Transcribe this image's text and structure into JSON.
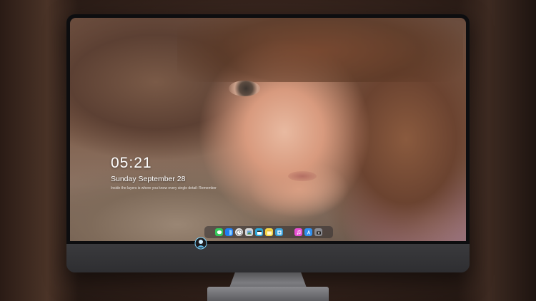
{
  "lockscreen": {
    "time": "05:21",
    "date": "Sunday September  28",
    "caption": "Inside the layers is where you know every single detail: Remember"
  },
  "dock": {
    "items": [
      {
        "name": "messages-icon",
        "color": "#34c759",
        "glyph": "◉"
      },
      {
        "name": "finder-icon",
        "color": "#1e7cf2",
        "glyph": "◧"
      },
      {
        "name": "clock-icon",
        "color": "#e8e8e8",
        "glyph": "◔"
      },
      {
        "name": "photos-icon",
        "color": "#c9c9c9",
        "glyph": "▦"
      },
      {
        "name": "claquette-icon",
        "color": "#2fa8d8",
        "glyph": "▤"
      },
      {
        "name": "notes-icon",
        "color": "#f5d547",
        "glyph": "▬"
      },
      {
        "name": "preview-icon",
        "color": "#3aa0d8",
        "glyph": "▣"
      },
      {
        "name": "itunes-icon",
        "color": "#e84fd1",
        "glyph": "♪"
      },
      {
        "name": "app-store-icon",
        "color": "#2f8ff0",
        "glyph": "A"
      },
      {
        "name": "camera-icon",
        "color": "#7a7a80",
        "glyph": "◙"
      }
    ]
  },
  "colors": {
    "bezel": "#0d0d0f",
    "chin": "#3a3a3d",
    "logo_accent": "#7fd6ff"
  }
}
